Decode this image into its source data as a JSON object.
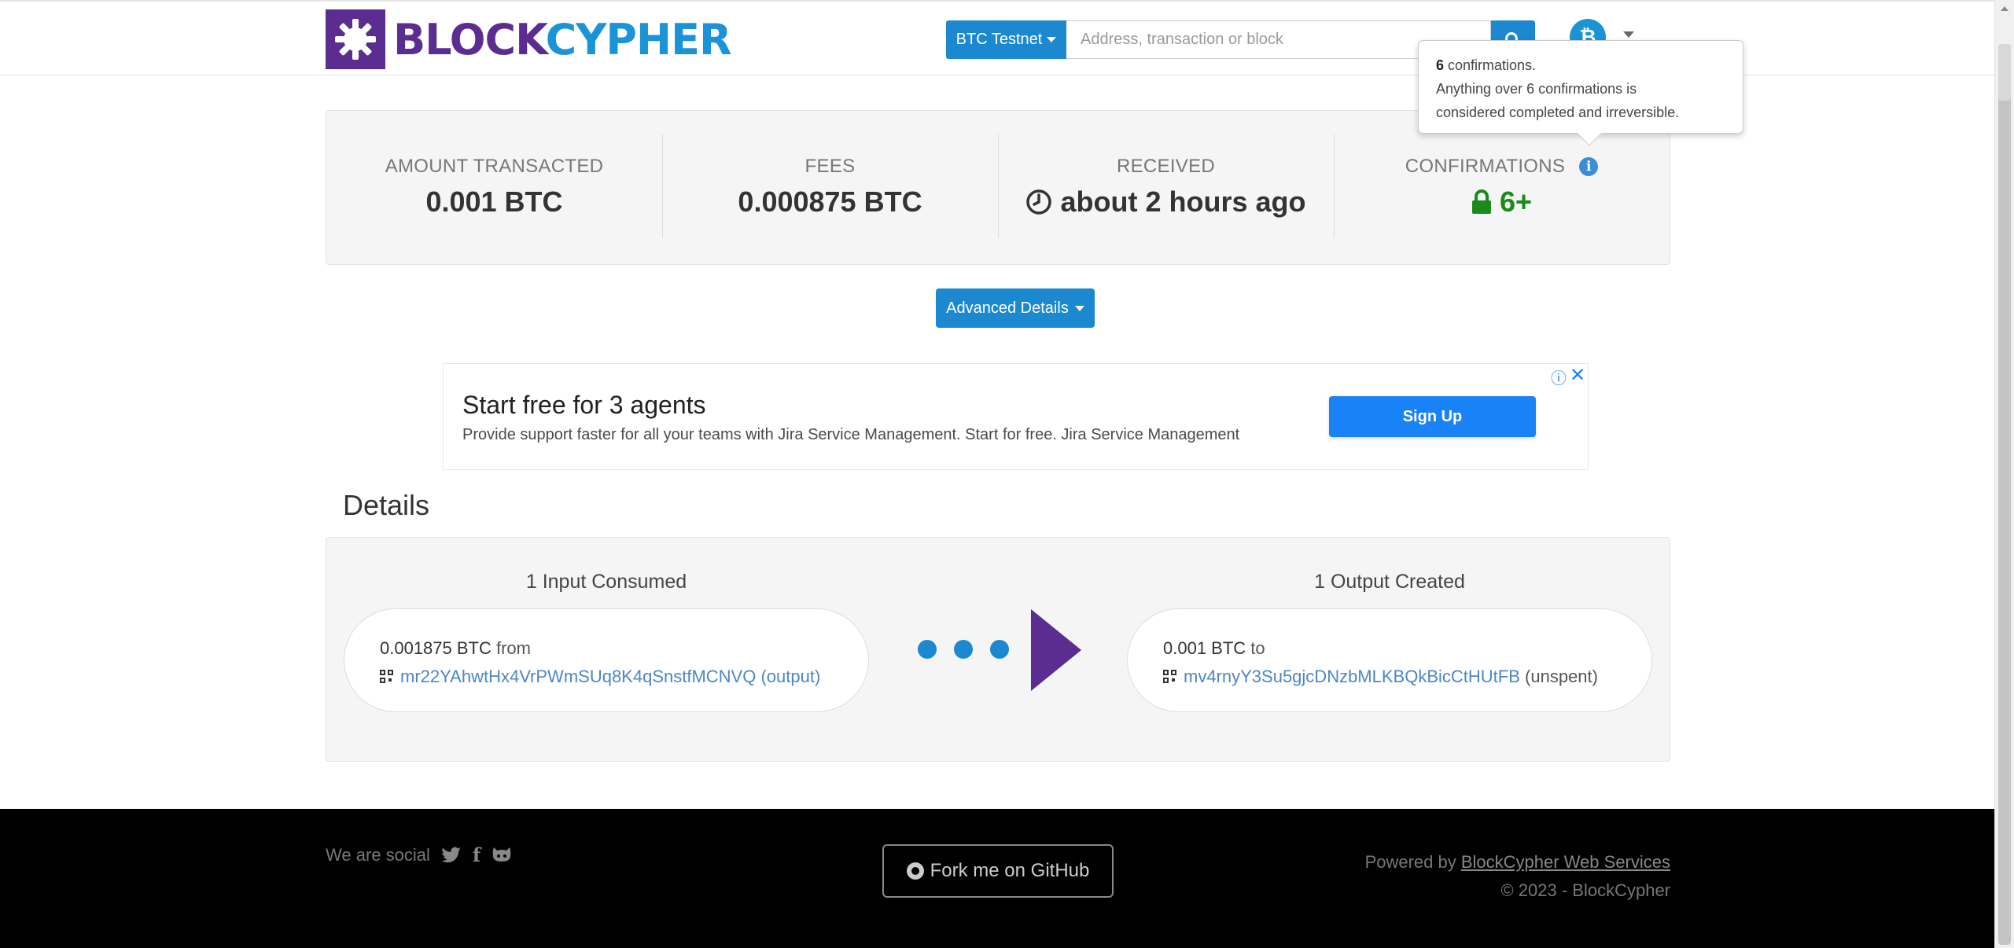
{
  "header": {
    "logo_part1": "BLOCK",
    "logo_part2": "CYPHER",
    "network_label": "BTC Testnet",
    "search_placeholder": "Address, transaction or block",
    "avatar_symbol": "₿"
  },
  "tooltip": {
    "count": "6",
    "line1_rest": " confirmations.",
    "line2": "Anything over 6 confirmations is",
    "line3": "considered completed and irreversible."
  },
  "stats": {
    "amount_label": "AMOUNT TRANSACTED",
    "amount_value": "0.001 BTC",
    "fees_label": "FEES",
    "fees_value": "0.000875 BTC",
    "received_label": "RECEIVED",
    "received_value": "about 2 hours ago",
    "confirmations_label": "CONFIRMATIONS",
    "confirmations_value": "6+"
  },
  "advanced_button": "Advanced Details",
  "ad": {
    "title": "Start free for 3 agents",
    "description": "Provide support faster for all your teams with Jira Service Management. Start for free. Jira Service Management",
    "button": "Sign Up"
  },
  "details": {
    "title": "Details",
    "inputs_title": "1 Input Consumed",
    "input_amount": "0.001875 BTC",
    "input_from": " from",
    "input_address": "mr22YAhwtHx4VrPWmSUq8K4qSnstfMCNVQ",
    "input_link": "(output)",
    "outputs_title": "1 Output Created",
    "output_amount": "0.001 BTC",
    "output_to": " to",
    "output_address": "mv4rnyY3Su5gjcDNzbMLKBQkBicCtHUtFB",
    "output_status": "(unspent)"
  },
  "footer": {
    "social_label": "We are social",
    "fork_label": "Fork me on GitHub",
    "powered_prefix": "Powered by ",
    "powered_link": "BlockCypher Web Services",
    "copyright": "© 2023 - BlockCypher"
  },
  "colors": {
    "brand_purple": "#5b2d91",
    "brand_blue": "#1b94d7",
    "button_blue": "#1b88d0",
    "confirm_green": "#1a8a1a"
  }
}
